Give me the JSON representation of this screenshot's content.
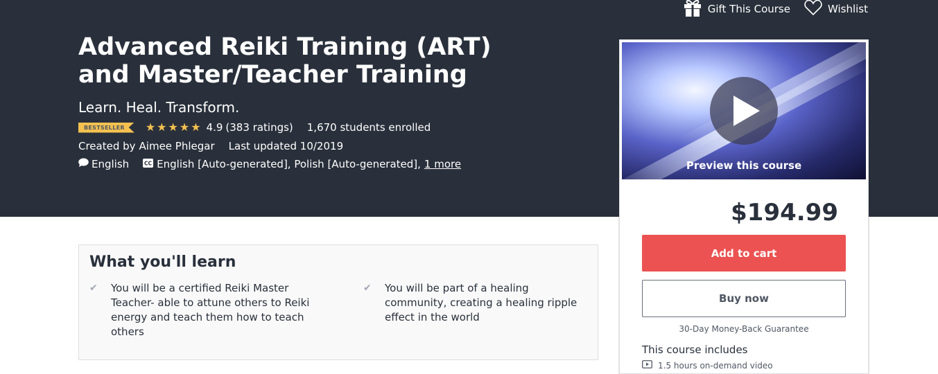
{
  "header": {
    "gift_label": "Gift This Course",
    "wishlist_label": "Wishlist"
  },
  "course": {
    "title": "Advanced Reiki Training (ART) and Master/Teacher Training",
    "subtitle": "Learn. Heal. Transform.",
    "badge": "BESTSELLER",
    "rating_value": "4.9",
    "rating_count": "(383 ratings)",
    "stars": 5,
    "enrolled": "1,670 students enrolled",
    "created_by_label": "Created by",
    "author": "Aimee Phlegar",
    "last_updated": "Last updated 10/2019",
    "language": "English",
    "captions": "English [Auto-generated], Polish [Auto-generated],",
    "captions_more": "1 more"
  },
  "learn": {
    "title": "What you'll learn",
    "items": [
      "You will be a certified Reiki Master Teacher- able to attune others to Reiki energy and teach them how to teach others",
      "You will be part of a healing community, creating a healing ripple effect in the world"
    ]
  },
  "sidebar": {
    "preview_label": "Preview this course",
    "price": "$194.99",
    "add_to_cart": "Add to cart",
    "buy_now": "Buy now",
    "guarantee": "30-Day Money-Back Guarantee",
    "includes_title": "This course includes",
    "includes_items": [
      "1.5 hours on-demand video"
    ]
  },
  "colors": {
    "hero_bg": "#29303b",
    "star": "#f4c150",
    "cart_button": "#ec5252"
  },
  "icons": [
    "gift-icon",
    "heart-icon",
    "star-icon",
    "speech-bubble-icon",
    "closed-captions-icon",
    "check-icon",
    "play-icon",
    "video-icon"
  ]
}
